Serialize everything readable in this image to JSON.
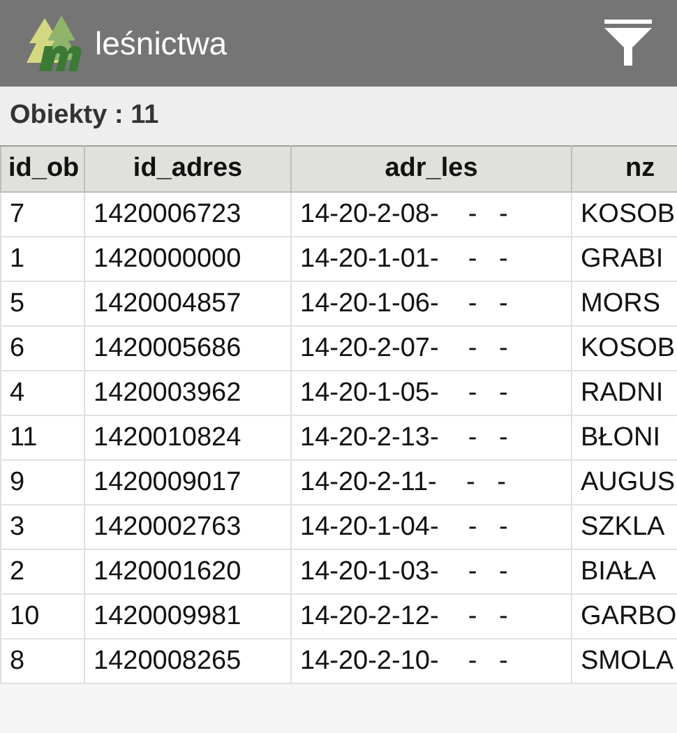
{
  "app_bar": {
    "title": "leśnictwa"
  },
  "summary": "Obiekty : 11",
  "table": {
    "columns": [
      "id_ob",
      "id_adres",
      "adr_les",
      "nz"
    ],
    "rows": [
      [
        "7",
        "1420006723",
        "14-20-2-08-    -   -",
        "KOSOB"
      ],
      [
        "1",
        "1420000000",
        "14-20-1-01-    -   -",
        "GRABI"
      ],
      [
        "5",
        "1420004857",
        "14-20-1-06-    -   -",
        "MORS"
      ],
      [
        "6",
        "1420005686",
        "14-20-2-07-    -   -",
        "KOSOB"
      ],
      [
        "4",
        "1420003962",
        "14-20-1-05-    -   -",
        "RADNI"
      ],
      [
        "11",
        "1420010824",
        "14-20-2-13-    -   -",
        "BŁONI"
      ],
      [
        "9",
        "1420009017",
        "14-20-2-11-    -   -",
        "AUGUS"
      ],
      [
        "3",
        "1420002763",
        "14-20-1-04-    -   -",
        "SZKLA"
      ],
      [
        "2",
        "1420001620",
        "14-20-1-03-    -   -",
        "BIAŁA"
      ],
      [
        "10",
        "1420009981",
        "14-20-2-12-    -   -",
        "GARBO"
      ],
      [
        "8",
        "1420008265",
        "14-20-2-10-    -   -",
        "SMOLA"
      ]
    ]
  }
}
